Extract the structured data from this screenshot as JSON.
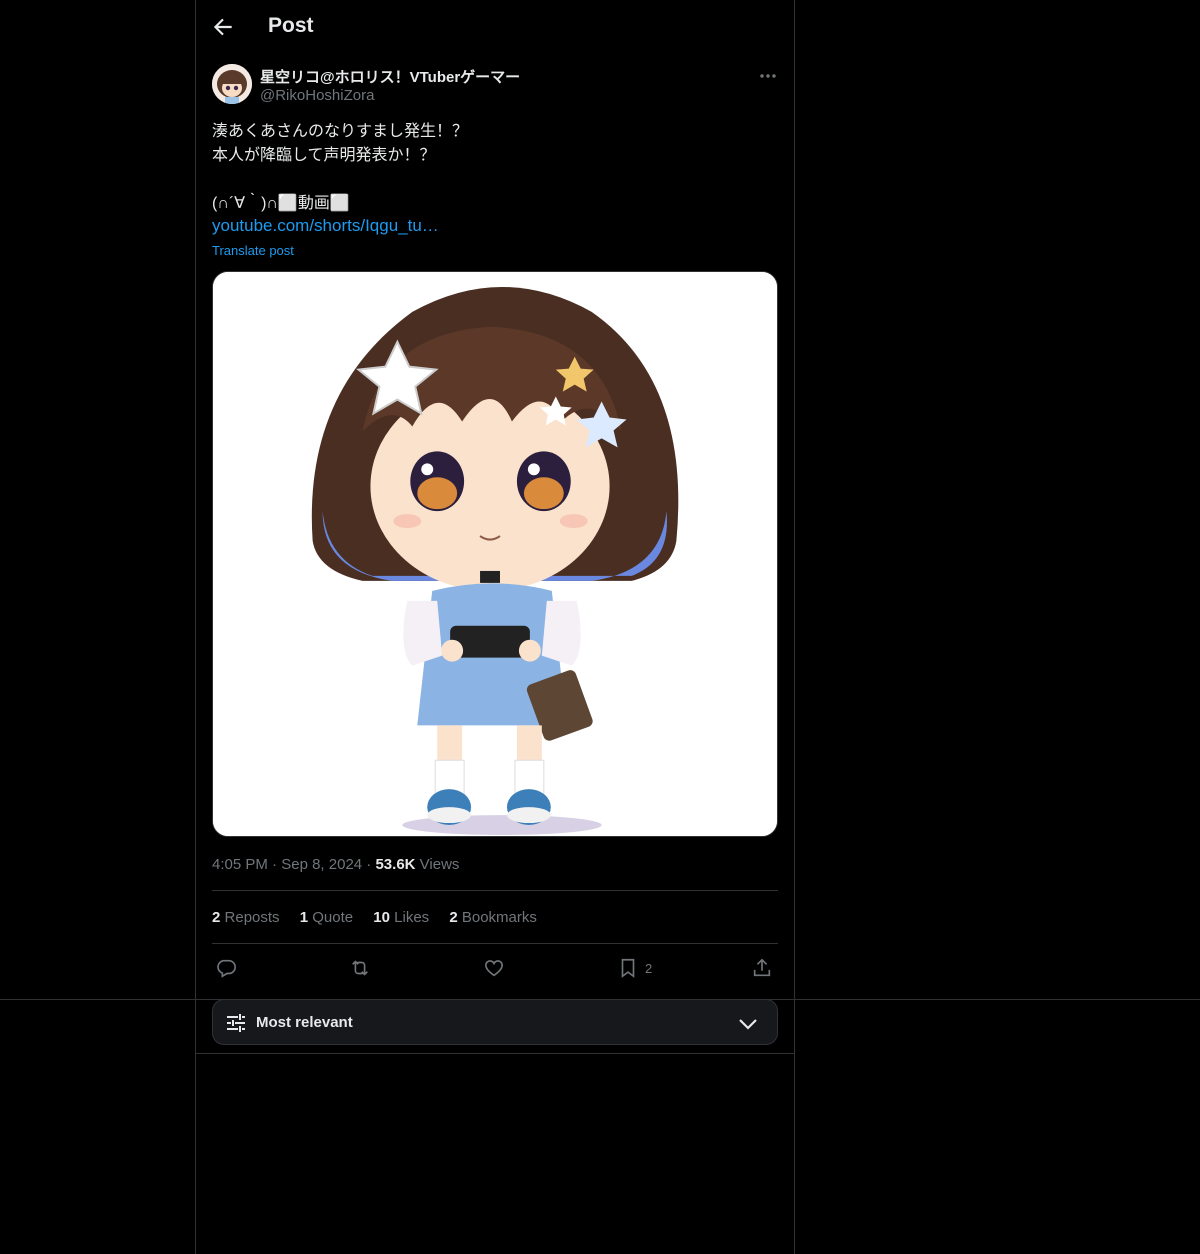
{
  "header": {
    "title": "Post"
  },
  "post": {
    "author_name": "星空リコ@ホロリス！VTuberゲーマー",
    "author_handle": "@RikoHoshiZora",
    "text": "湊あくあさんのなりすまし発生！？\n本人が降臨して声明発表か！？\n\n(∩´∀｀)∩⬜動画⬜",
    "link": "youtube.com/shorts/Iqgu_tu…",
    "translate_label": "Translate post",
    "time": "4:05 PM",
    "date": "Sep 8, 2024",
    "views_count": "53.6K",
    "views_label": "Views"
  },
  "stats": [
    {
      "count": "2",
      "label": "Reposts"
    },
    {
      "count": "1",
      "label": "Quote"
    },
    {
      "count": "10",
      "label": "Likes"
    },
    {
      "count": "2",
      "label": "Bookmarks"
    }
  ],
  "actions": {
    "reply_icon": "reply-icon",
    "repost_icon": "repost-icon",
    "like_icon": "heart-icon",
    "bookmark_icon": "bookmark-icon",
    "bookmark_count": "2",
    "share_icon": "share-icon"
  },
  "replies_sort": {
    "label": "Most relevant"
  },
  "colors": {
    "accent": "#1d9bf0",
    "background": "#000000",
    "muted": "#71767b",
    "border": "#2f3336"
  }
}
